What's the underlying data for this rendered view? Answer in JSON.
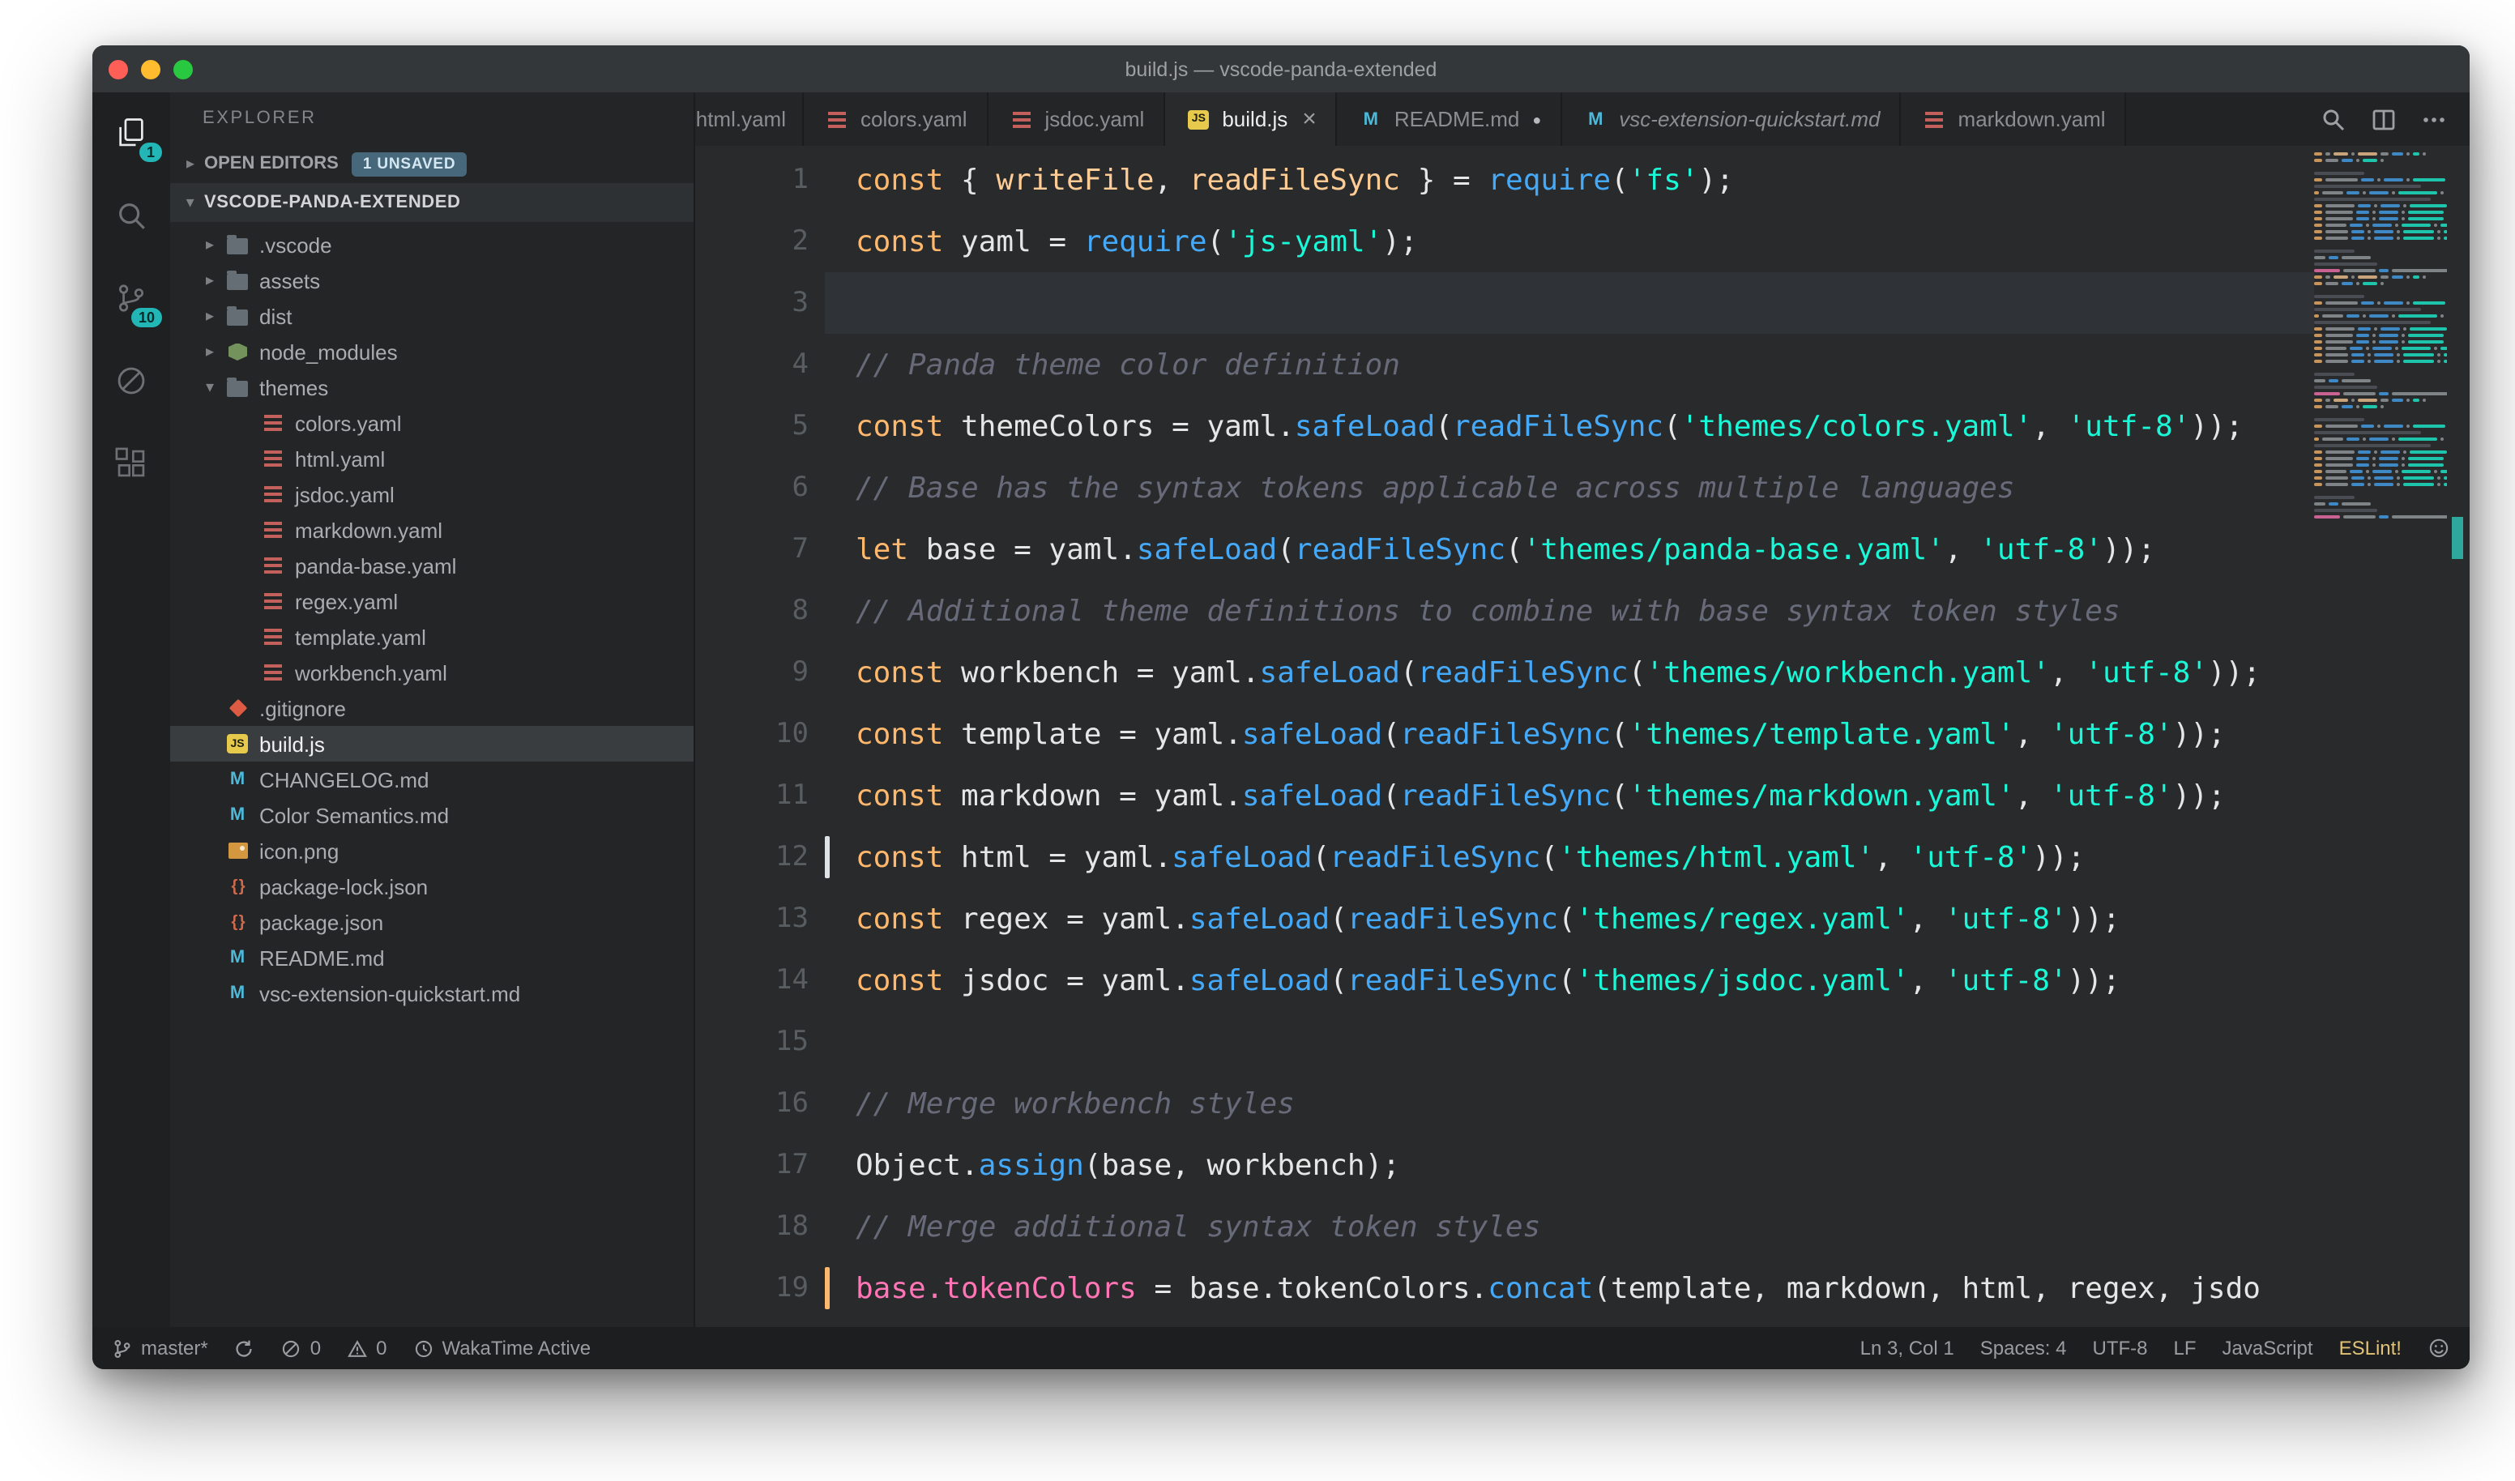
{
  "colors": {
    "accent_teal": "#19f9d8",
    "keyword_orange": "#ffb86c",
    "function_blue": "#45a9f9",
    "string_teal": "#19f9d8",
    "comment_gray": "#676b79",
    "pink": "#ff75b5",
    "param_cream": "#ffcc95",
    "badge_teal": "#23b6b6",
    "eslint_yellow": "#e2c275"
  },
  "title_bar": {
    "title": "build.js — vscode-panda-extended"
  },
  "activity_bar": {
    "items": [
      {
        "id": "explorer",
        "icon": "files",
        "badge": "1",
        "active": true
      },
      {
        "id": "search",
        "icon": "search"
      },
      {
        "id": "source-control",
        "icon": "git",
        "badge": "10"
      },
      {
        "id": "debug",
        "icon": "debug"
      },
      {
        "id": "extensions",
        "icon": "extensions"
      }
    ]
  },
  "sidebar": {
    "header": "EXPLORER",
    "open_editors": {
      "arrow": "▸",
      "label": "OPEN EDITORS",
      "badge": "1 UNSAVED"
    },
    "project": {
      "arrow": "▾",
      "label": "VSCODE-PANDA-EXTENDED"
    },
    "tree": [
      {
        "label": ".vscode",
        "icon": "folder",
        "arrow": "▸",
        "depth": 0
      },
      {
        "label": "assets",
        "icon": "folder",
        "arrow": "▸",
        "depth": 0
      },
      {
        "label": "dist",
        "icon": "folder",
        "arrow": "▸",
        "depth": 0
      },
      {
        "label": "node_modules",
        "icon": "node",
        "arrow": "▸",
        "depth": 0
      },
      {
        "label": "themes",
        "icon": "folder",
        "arrow": "▾",
        "depth": 0
      },
      {
        "label": "colors.yaml",
        "icon": "yaml",
        "depth": 1
      },
      {
        "label": "html.yaml",
        "icon": "yaml",
        "depth": 1
      },
      {
        "label": "jsdoc.yaml",
        "icon": "yaml",
        "depth": 1
      },
      {
        "label": "markdown.yaml",
        "icon": "yaml",
        "depth": 1
      },
      {
        "label": "panda-base.yaml",
        "icon": "yaml",
        "depth": 1
      },
      {
        "label": "regex.yaml",
        "icon": "yaml",
        "depth": 1
      },
      {
        "label": "template.yaml",
        "icon": "yaml",
        "depth": 1
      },
      {
        "label": "workbench.yaml",
        "icon": "yaml",
        "depth": 1
      },
      {
        "label": ".gitignore",
        "icon": "git",
        "depth": 0
      },
      {
        "label": "build.js",
        "icon": "js",
        "depth": 0,
        "selected": true
      },
      {
        "label": "CHANGELOG.md",
        "icon": "md",
        "depth": 0
      },
      {
        "label": "Color Semantics.md",
        "icon": "md",
        "depth": 0
      },
      {
        "label": "icon.png",
        "icon": "image",
        "depth": 0
      },
      {
        "label": "package-lock.json",
        "icon": "json",
        "depth": 0
      },
      {
        "label": "package.json",
        "icon": "json",
        "depth": 0
      },
      {
        "label": "README.md",
        "icon": "md",
        "depth": 0
      },
      {
        "label": "vsc-extension-quickstart.md",
        "icon": "md",
        "depth": 0
      }
    ]
  },
  "tab_bar": {
    "tabs": [
      {
        "label": "html.yaml",
        "icon": "yaml",
        "clipped": true
      },
      {
        "label": "colors.yaml",
        "icon": "yaml"
      },
      {
        "label": "jsdoc.yaml",
        "icon": "yaml"
      },
      {
        "label": "build.js",
        "icon": "js",
        "active": true,
        "close": "×"
      },
      {
        "label": "README.md",
        "icon": "md",
        "dirty": "●"
      },
      {
        "label": "vsc-extension-quickstart.md",
        "icon": "md",
        "preview": true
      },
      {
        "label": "markdown.yaml",
        "icon": "yaml"
      }
    ],
    "actions": [
      {
        "id": "open-preview",
        "icon": "preview"
      },
      {
        "id": "split-editor",
        "icon": "split"
      },
      {
        "id": "more-actions",
        "icon": "ellipsis"
      }
    ]
  },
  "editor": {
    "current_line": 3,
    "gutter_marks": [
      {
        "line": 12,
        "color": "#dfe3e6"
      },
      {
        "line": 19,
        "color": "#ffb86c"
      }
    ],
    "lines": [
      {
        "n": 1,
        "segs": [
          [
            "k",
            "const"
          ],
          [
            "d",
            " { "
          ],
          [
            "v",
            "writeFile"
          ],
          [
            "d",
            ", "
          ],
          [
            "v",
            "readFileSync"
          ],
          [
            "d",
            " } = "
          ],
          [
            "f",
            "require"
          ],
          [
            "d",
            "("
          ],
          [
            "s",
            "'fs'"
          ],
          [
            "d",
            ");"
          ]
        ]
      },
      {
        "n": 2,
        "segs": [
          [
            "k",
            "const"
          ],
          [
            "d",
            " yaml = "
          ],
          [
            "f",
            "require"
          ],
          [
            "d",
            "("
          ],
          [
            "s",
            "'js-yaml'"
          ],
          [
            "d",
            ");"
          ]
        ]
      },
      {
        "n": 3,
        "segs": []
      },
      {
        "n": 4,
        "segs": [
          [
            "c",
            "// Panda theme color definition"
          ]
        ]
      },
      {
        "n": 5,
        "segs": [
          [
            "k",
            "const"
          ],
          [
            "d",
            " themeColors = yaml."
          ],
          [
            "f",
            "safeLoad"
          ],
          [
            "d",
            "("
          ],
          [
            "f",
            "readFileSync"
          ],
          [
            "d",
            "("
          ],
          [
            "s",
            "'themes/colors.yaml'"
          ],
          [
            "d",
            ", "
          ],
          [
            "s",
            "'utf-8'"
          ],
          [
            "d",
            "));"
          ]
        ]
      },
      {
        "n": 6,
        "segs": [
          [
            "c",
            "// Base has the syntax tokens applicable across multiple languages"
          ]
        ]
      },
      {
        "n": 7,
        "segs": [
          [
            "k",
            "let"
          ],
          [
            "d",
            " base = yaml."
          ],
          [
            "f",
            "safeLoad"
          ],
          [
            "d",
            "("
          ],
          [
            "f",
            "readFileSync"
          ],
          [
            "d",
            "("
          ],
          [
            "s",
            "'themes/panda-base.yaml'"
          ],
          [
            "d",
            ", "
          ],
          [
            "s",
            "'utf-8'"
          ],
          [
            "d",
            "));"
          ]
        ]
      },
      {
        "n": 8,
        "segs": [
          [
            "c",
            "// Additional theme definitions to combine with base syntax token styles"
          ]
        ]
      },
      {
        "n": 9,
        "segs": [
          [
            "k",
            "const"
          ],
          [
            "d",
            " workbench = yaml."
          ],
          [
            "f",
            "safeLoad"
          ],
          [
            "d",
            "("
          ],
          [
            "f",
            "readFileSync"
          ],
          [
            "d",
            "("
          ],
          [
            "s",
            "'themes/workbench.yaml'"
          ],
          [
            "d",
            ", "
          ],
          [
            "s",
            "'utf-8'"
          ],
          [
            "d",
            "));"
          ]
        ]
      },
      {
        "n": 10,
        "segs": [
          [
            "k",
            "const"
          ],
          [
            "d",
            " template = yaml."
          ],
          [
            "f",
            "safeLoad"
          ],
          [
            "d",
            "("
          ],
          [
            "f",
            "readFileSync"
          ],
          [
            "d",
            "("
          ],
          [
            "s",
            "'themes/template.yaml'"
          ],
          [
            "d",
            ", "
          ],
          [
            "s",
            "'utf-8'"
          ],
          [
            "d",
            "));"
          ]
        ]
      },
      {
        "n": 11,
        "segs": [
          [
            "k",
            "const"
          ],
          [
            "d",
            " markdown = yaml."
          ],
          [
            "f",
            "safeLoad"
          ],
          [
            "d",
            "("
          ],
          [
            "f",
            "readFileSync"
          ],
          [
            "d",
            "("
          ],
          [
            "s",
            "'themes/markdown.yaml'"
          ],
          [
            "d",
            ", "
          ],
          [
            "s",
            "'utf-8'"
          ],
          [
            "d",
            "));"
          ]
        ]
      },
      {
        "n": 12,
        "segs": [
          [
            "k",
            "const"
          ],
          [
            "d",
            " html = yaml."
          ],
          [
            "f",
            "safeLoad"
          ],
          [
            "d",
            "("
          ],
          [
            "f",
            "readFileSync"
          ],
          [
            "d",
            "("
          ],
          [
            "s",
            "'themes/html.yaml'"
          ],
          [
            "d",
            ", "
          ],
          [
            "s",
            "'utf-8'"
          ],
          [
            "d",
            "));"
          ]
        ]
      },
      {
        "n": 13,
        "segs": [
          [
            "k",
            "const"
          ],
          [
            "d",
            " regex = yaml."
          ],
          [
            "f",
            "safeLoad"
          ],
          [
            "d",
            "("
          ],
          [
            "f",
            "readFileSync"
          ],
          [
            "d",
            "("
          ],
          [
            "s",
            "'themes/regex.yaml'"
          ],
          [
            "d",
            ", "
          ],
          [
            "s",
            "'utf-8'"
          ],
          [
            "d",
            "));"
          ]
        ]
      },
      {
        "n": 14,
        "segs": [
          [
            "k",
            "const"
          ],
          [
            "d",
            " jsdoc = yaml."
          ],
          [
            "f",
            "safeLoad"
          ],
          [
            "d",
            "("
          ],
          [
            "f",
            "readFileSync"
          ],
          [
            "d",
            "("
          ],
          [
            "s",
            "'themes/jsdoc.yaml'"
          ],
          [
            "d",
            ", "
          ],
          [
            "s",
            "'utf-8'"
          ],
          [
            "d",
            "));"
          ]
        ]
      },
      {
        "n": 15,
        "segs": []
      },
      {
        "n": 16,
        "segs": [
          [
            "c",
            "// Merge workbench styles"
          ]
        ]
      },
      {
        "n": 17,
        "segs": [
          [
            "d",
            "Object."
          ],
          [
            "f",
            "assign"
          ],
          [
            "d",
            "(base, workbench);"
          ]
        ]
      },
      {
        "n": 18,
        "segs": [
          [
            "c",
            "// Merge additional syntax token styles"
          ]
        ]
      },
      {
        "n": 19,
        "segs": [
          [
            "pk",
            "base.tokenColors"
          ],
          [
            "d",
            " = base.tokenColors."
          ],
          [
            "f",
            "concat"
          ],
          [
            "d",
            "(template, markdown, html, regex, jsdo"
          ]
        ]
      }
    ]
  },
  "status_bar": {
    "left": [
      {
        "id": "branch",
        "icon": "branch",
        "text": "master*"
      },
      {
        "id": "sync",
        "icon": "sync",
        "text": ""
      },
      {
        "id": "errors",
        "icon": "error",
        "text": "0"
      },
      {
        "id": "warnings",
        "icon": "warning",
        "text": "0"
      },
      {
        "id": "wakatime",
        "icon": "clock",
        "text": "WakaTime Active"
      }
    ],
    "right": [
      {
        "id": "cursor-position",
        "text": "Ln 3, Col 1"
      },
      {
        "id": "indentation",
        "text": "Spaces: 4"
      },
      {
        "id": "encoding",
        "text": "UTF-8"
      },
      {
        "id": "eol",
        "text": "LF"
      },
      {
        "id": "language",
        "text": "JavaScript"
      },
      {
        "id": "eslint",
        "text": "ESLint!",
        "color": "#e2c275"
      },
      {
        "id": "feedback",
        "icon": "smiley",
        "text": ""
      }
    ]
  }
}
